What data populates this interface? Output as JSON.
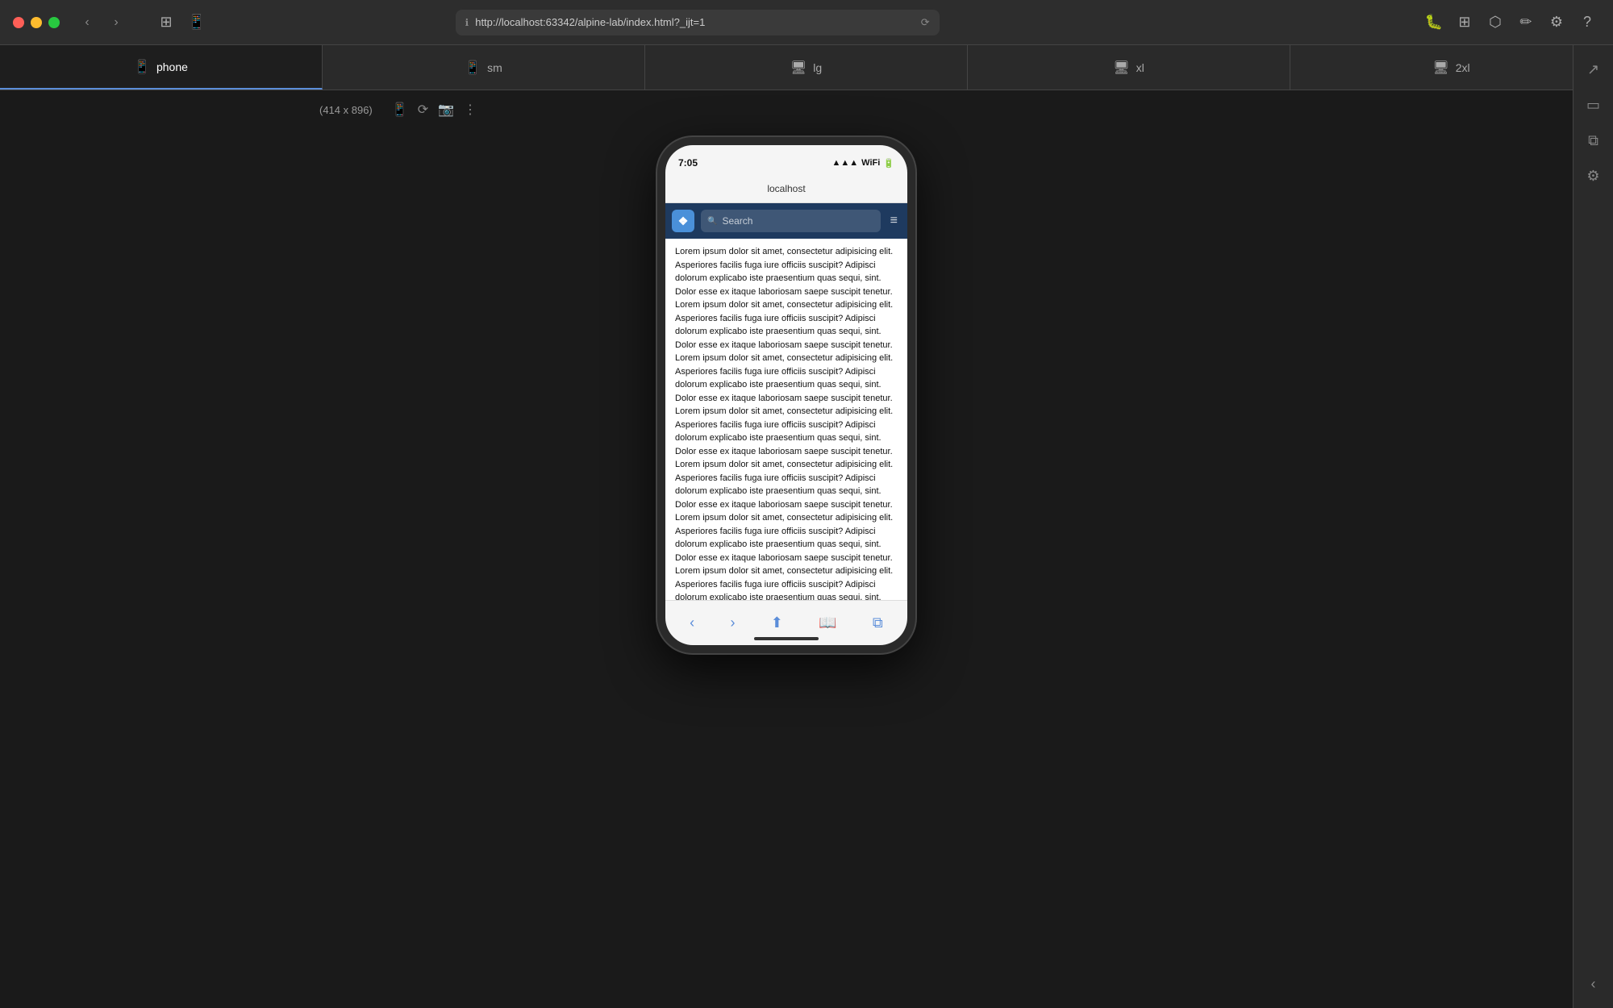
{
  "titlebar": {
    "url": "http://localhost:63342/alpine-lab/index.html?_ijt=1",
    "reload_label": "⟳"
  },
  "breakpoints": {
    "tabs": [
      {
        "id": "phone",
        "icon": "📱",
        "label": "phone",
        "active": true
      },
      {
        "id": "sm",
        "icon": "📱",
        "label": "sm",
        "active": false
      },
      {
        "id": "lg",
        "icon": "🖥",
        "label": "lg",
        "active": false
      },
      {
        "id": "xl",
        "icon": "🖥",
        "label": "xl",
        "active": false
      },
      {
        "id": "2xl",
        "icon": "🖥",
        "label": "2xl",
        "active": false
      }
    ]
  },
  "device": {
    "dimensions": "(414 x 896)",
    "phone_icon": "📱",
    "rotate_icon": "⟳",
    "screenshot_icon": "📷",
    "more_icon": "⋮"
  },
  "phone": {
    "status_time": "7:05",
    "url_bar": "localhost",
    "search_placeholder": "Search",
    "logo_text": "❖",
    "lorem_text": "Lorem ipsum dolor sit amet, consectetur adipisicing elit. Asperiores facilis fuga iure officiis suscipit? Adipisci dolorum explicabo iste praesentium quas sequi, sint. Dolor esse ex itaque laboriosam saepe suscipit tenetur. Lorem ipsum dolor sit amet, consectetur adipisicing elit. Asperiores facilis fuga iure officiis suscipit? Adipisci dolorum explicabo iste praesentium quas sequi, sint. Dolor esse ex itaque laboriosam saepe suscipit tenetur. Lorem ipsum dolor sit amet, consectetur adipisicing elit. Asperiores facilis fuga iure officiis suscipit? Adipisci dolorum explicabo iste praesentium quas sequi, sint. Dolor esse ex itaque laboriosam saepe suscipit tenetur. Lorem ipsum dolor sit amet, consectetur adipisicing elit. Asperiores facilis fuga iure officiis suscipit? Adipisci dolorum explicabo iste praesentium quas sequi, sint. Dolor esse ex itaque laboriosam saepe suscipit tenetur. Lorem ipsum dolor sit amet, consectetur adipisicing elit. Asperiores facilis fuga iure officiis suscipit? Adipisci dolorum explicabo iste praesentium quas sequi, sint. Dolor esse ex itaque laboriosam saepe suscipit tenetur. Lorem ipsum dolor sit amet, consectetur adipisicing elit. Asperiores facilis fuga iure officiis suscipit? Adipisci dolorum explicabo iste praesentium quas sequi, sint. Dolor esse ex itaque laboriosam saepe suscipit tenetur. Lorem ipsum dolor sit amet, consectetur adipisicing elit. Asperiores facilis fuga iure officiis suscipit? Adipisci dolorum explicabo iste praesentium quas sequi, sint."
  },
  "sidebar_right": {
    "icons": [
      {
        "id": "external-link",
        "symbol": "↗"
      },
      {
        "id": "credit-card",
        "symbol": "💳"
      },
      {
        "id": "layers",
        "symbol": "⧉"
      },
      {
        "id": "settings",
        "symbol": "⚙"
      },
      {
        "id": "chevron-left",
        "symbol": "‹"
      }
    ]
  }
}
